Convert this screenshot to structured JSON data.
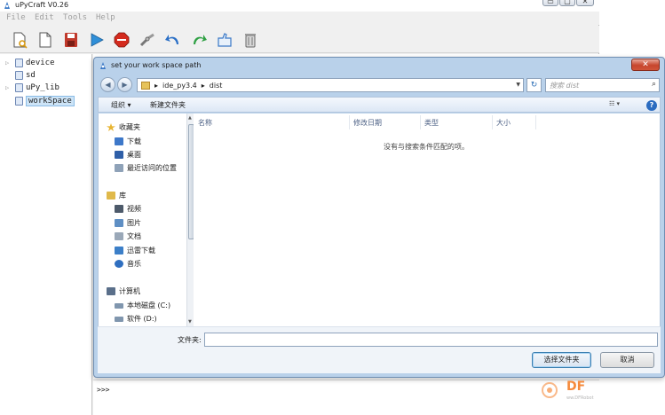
{
  "app": {
    "title": "uPyCraft V0.26",
    "window_buttons": [
      "▭",
      "▢",
      "✕"
    ],
    "menu": [
      "File",
      "Edit",
      "Tools",
      "Help"
    ],
    "toolbar_icons": [
      "new-file-icon",
      "open-file-icon",
      "save-icon",
      "run-icon",
      "stop-icon",
      "connect-icon",
      "undo-icon",
      "redo-icon",
      "sync-icon",
      "delete-icon"
    ],
    "tree": [
      {
        "label": "device",
        "expandable": true
      },
      {
        "label": "sd",
        "expandable": false
      },
      {
        "label": "uPy_lib",
        "expandable": true
      },
      {
        "label": "workSpace",
        "expandable": false,
        "selected": true
      }
    ],
    "console_prompt": ">>>"
  },
  "dialog": {
    "title": "set your work space path",
    "close": "✕",
    "nav_back": "◀",
    "nav_forward": "▶",
    "path_segments": [
      "ide_py3.4",
      "dist"
    ],
    "path_sep": "▸",
    "refresh": "↻",
    "search_placeholder": "搜索 dist",
    "search_icon": "⌕",
    "organize": "组织 ▾",
    "new_folder": "新建文件夹",
    "view": "☷ ▾",
    "help": "?",
    "nav_items": [
      {
        "label": "收藏夹",
        "icon": "star-icon",
        "color": "#e8b533"
      },
      {
        "label": "下载",
        "icon": "download-icon",
        "color": "#3d78c9"
      },
      {
        "label": "桌面",
        "icon": "desktop-icon",
        "color": "#2f5fa8"
      },
      {
        "label": "最近访问的位置",
        "icon": "recent-icon",
        "color": "#8fa2b8"
      },
      {
        "label": "库",
        "icon": "library-icon",
        "color": "#e0b94a"
      },
      {
        "label": "视频",
        "icon": "video-icon",
        "color": "#4d5a6a"
      },
      {
        "label": "图片",
        "icon": "picture-icon",
        "color": "#5f8fc4"
      },
      {
        "label": "文档",
        "icon": "document-icon",
        "color": "#9aa8b8"
      },
      {
        "label": "迅雷下载",
        "icon": "thunder-icon",
        "color": "#3c7fc8"
      },
      {
        "label": "音乐",
        "icon": "music-icon",
        "color": "#2f6fc0"
      },
      {
        "label": "计算机",
        "icon": "computer-icon",
        "color": "#5a6f8a"
      },
      {
        "label": "本地磁盘 (C:)",
        "icon": "disk-c-icon",
        "color": "#8096ae"
      },
      {
        "label": "软件 (D:)",
        "icon": "disk-d-icon",
        "color": "#8096ae"
      }
    ],
    "columns": [
      "名称",
      "修改日期",
      "类型",
      "大小"
    ],
    "empty_message": "没有与搜索条件匹配的项。",
    "folder_label": "文件夹:",
    "folder_value": "",
    "select_button": "选择文件夹",
    "cancel_button": "取消"
  },
  "watermark": {
    "text": "DF",
    "sub": "ww.DFRobot"
  },
  "colors": {
    "accent": "#2b6cc0",
    "dialog_frame": "#b9d1ea",
    "watermark": "#f58a3c"
  }
}
